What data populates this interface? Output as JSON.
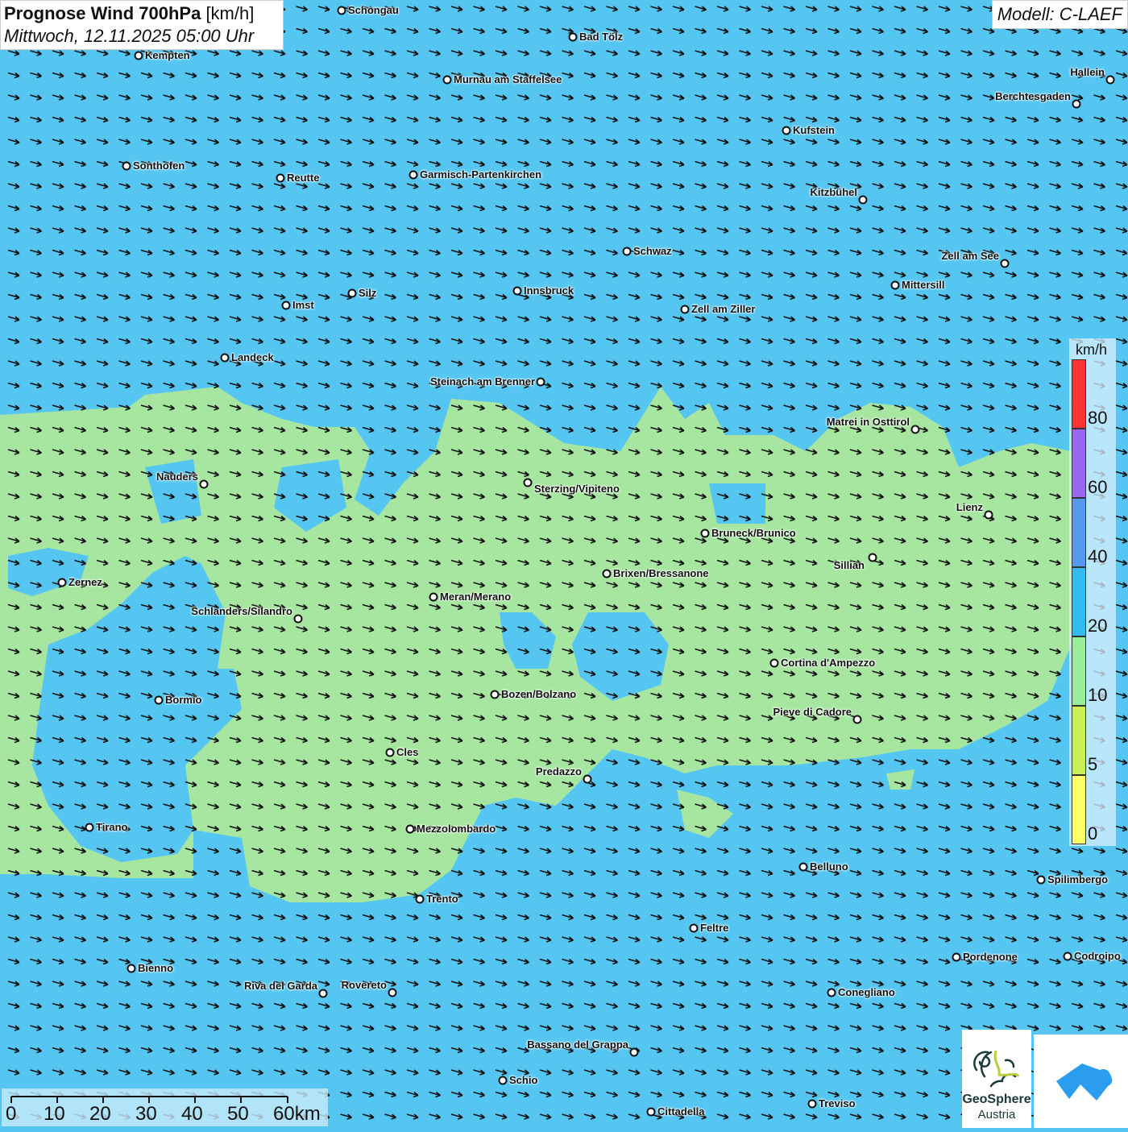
{
  "header": {
    "title": "Prognose Wind 700hPa",
    "unit": "[km/h]",
    "datetime": "Mittwoch, 12.11.2025 05:00 Uhr"
  },
  "model": "Modell: C-LAEF",
  "legend": {
    "unit": "km/h",
    "labels": [
      "80",
      "60",
      "40",
      "20",
      "10",
      "5",
      "0"
    ],
    "bins": [
      {
        "range": "80+",
        "color": "#ff3333"
      },
      {
        "range": "60-80",
        "color": "#9966ee"
      },
      {
        "range": "40-60",
        "color": "#5599ee"
      },
      {
        "range": "20-40",
        "color": "#33bbee"
      },
      {
        "range": "10-20",
        "color": "#99ee99"
      },
      {
        "range": "5-10",
        "color": "#ccee55"
      },
      {
        "range": "0-5",
        "color": "#ffff66"
      }
    ]
  },
  "colors": {
    "background_20_40": "#55c6f2",
    "area_10_20": "#a6e6a0",
    "arrows": "#111111"
  },
  "wind": {
    "direction": "west-northwest (arrows pointing east-southeast)"
  },
  "scale_bar": {
    "labels": [
      "0",
      "10",
      "20",
      "30",
      "40",
      "50",
      "60km"
    ]
  },
  "logos": {
    "geosphere_line1": "GeoSphere",
    "geosphere_line2": "Austria"
  },
  "cities": [
    "Schongau",
    "Bad Tölz",
    "Kempten",
    "Murnau am Staffelsee",
    "Hallein",
    "Berchtesgaden",
    "Kufstein",
    "Sonthofen",
    "Reutte",
    "Garmisch-Partenkirchen",
    "Kitzbühel",
    "Schwaz",
    "Zell am See",
    "Mittersill",
    "Silz",
    "Innsbruck",
    "Imst",
    "Zell am Ziller",
    "Landeck",
    "Steinach am Brenner",
    "Matrei in Osttirol",
    "Nauders",
    "Sterzing/Vipiteno",
    "Lienz",
    "Bruneck/Brunico",
    "Sillian",
    "Brixen/Bressanone",
    "Zernez",
    "Meran/Merano",
    "Schlanders/Silandro",
    "Cortina d'Ampezzo",
    "Bozen/Bolzano",
    "Bormio",
    "Pieve di Cadore",
    "Cles",
    "Predazzo",
    "Tirano",
    "Mezzolombardo",
    "Belluno",
    "Spilimbergo",
    "Trento",
    "Feltre",
    "Pordenone",
    "Codroipo",
    "Bienno",
    "Riva del Garda",
    "Rovereto",
    "Conegliano",
    "Bassano del Grappa",
    "Schio",
    "Treviso",
    "Cittadella"
  ]
}
